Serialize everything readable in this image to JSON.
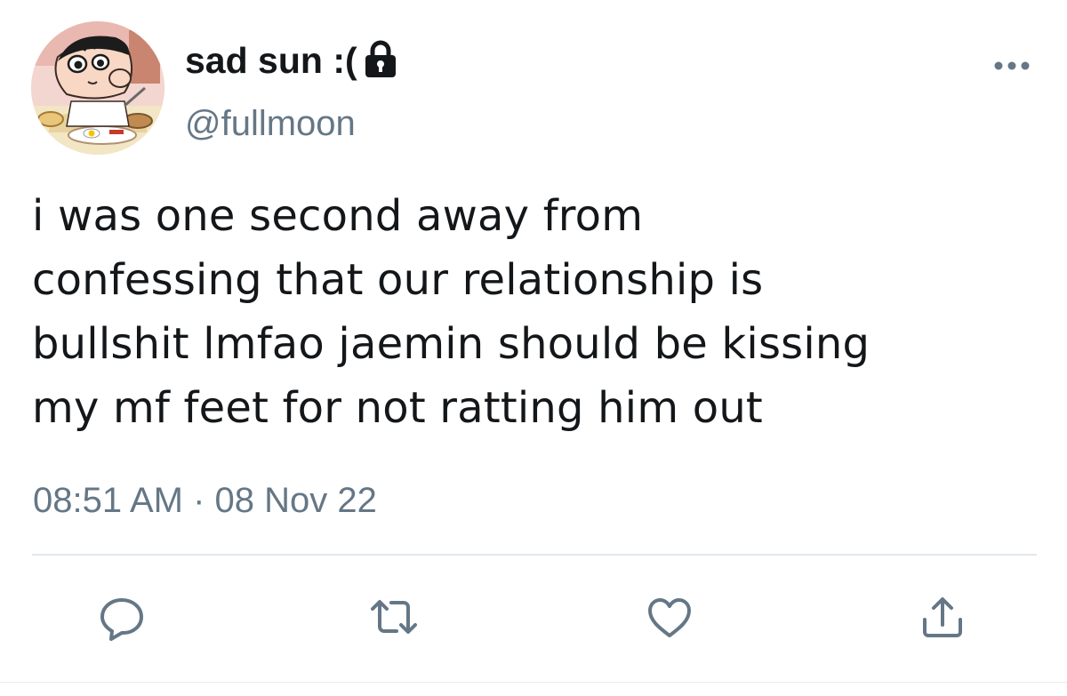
{
  "user": {
    "display_name": "sad sun :(",
    "handle": "@fullmoon",
    "protected": true,
    "avatar_icon": "avatar-cartoon-boy-icon"
  },
  "tweet": {
    "lines": [
      "i was one second away from",
      "confessing that our relationship is",
      "bullshit lmfao jaemin should be kissing",
      "my mf feet for not ratting him out"
    ],
    "timestamp": "08:51 AM · 08 Nov 22"
  },
  "actions": {
    "reply_icon": "reply-icon",
    "retweet_icon": "retweet-icon",
    "like_icon": "heart-icon",
    "share_icon": "share-icon"
  },
  "colors": {
    "text": "#14171a",
    "secondary": "#657786",
    "icon": "#657786",
    "divider": "#e1e8ed",
    "background": "#ffffff"
  }
}
